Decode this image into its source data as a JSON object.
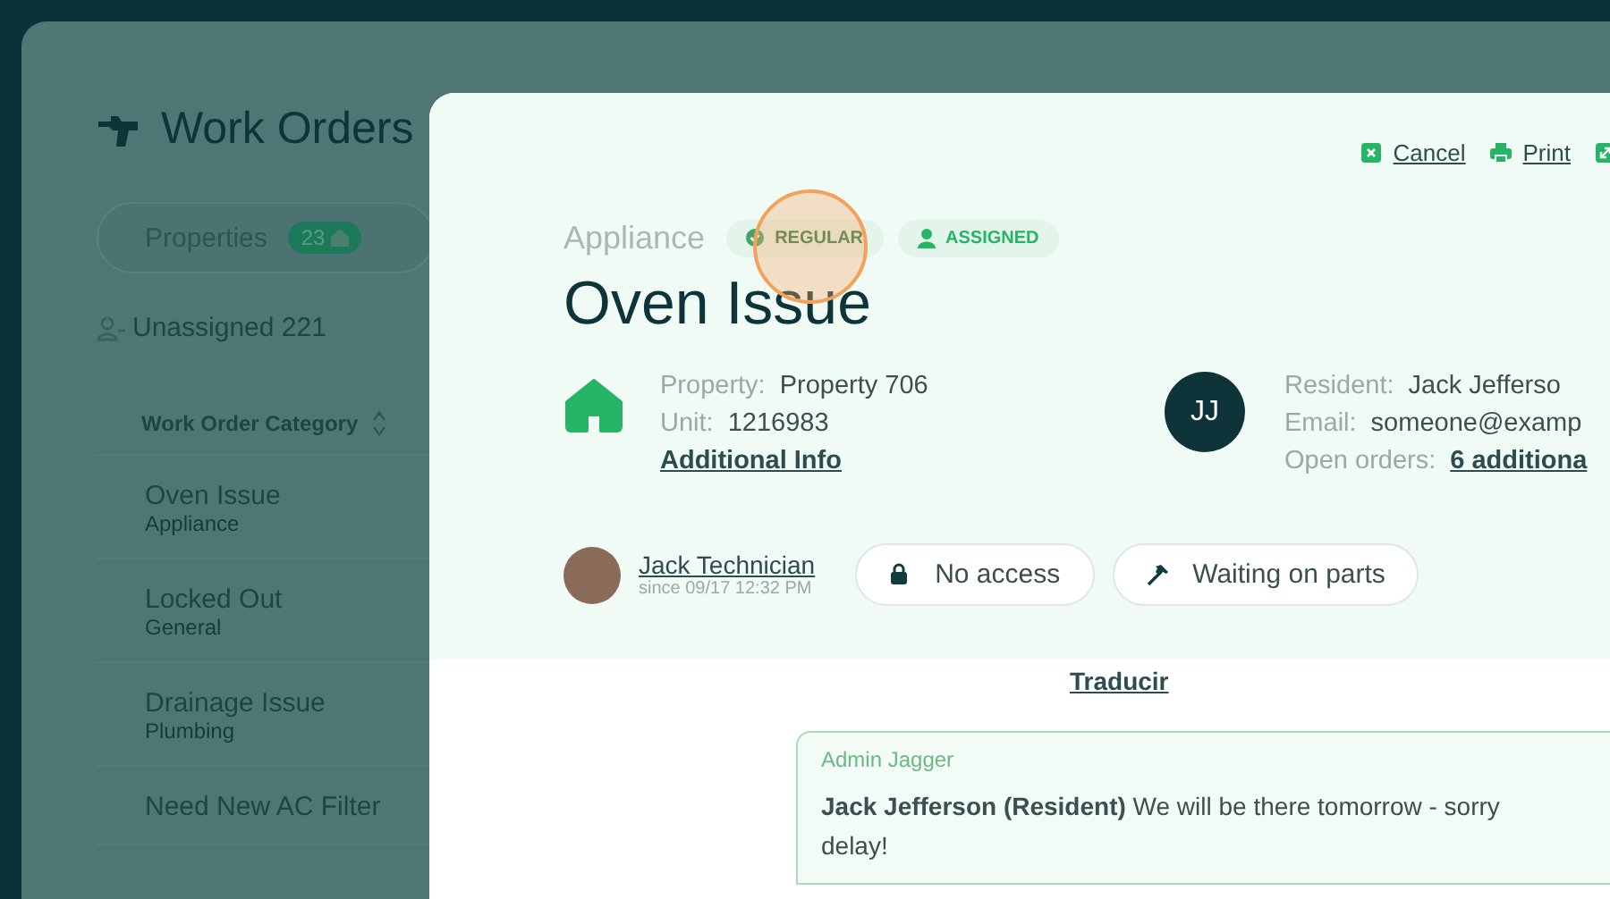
{
  "background": {
    "title": "Work Orders",
    "filter": {
      "label": "Properties",
      "count": "23"
    },
    "unassigned": "Unassigned 221",
    "table": {
      "column": "Work Order Category",
      "rows": [
        {
          "title": "Oven Issue",
          "category": "Appliance"
        },
        {
          "title": "Locked Out",
          "category": "General"
        },
        {
          "title": "Drainage Issue",
          "category": "Plumbing"
        },
        {
          "title": "Need New AC Filter"
        }
      ]
    }
  },
  "modal": {
    "actions": [
      {
        "kind": "cancel",
        "label": "Cancel"
      },
      {
        "kind": "print",
        "label": "Print"
      },
      {
        "kind": "expand"
      }
    ],
    "category": "Appliance",
    "badges": [
      {
        "kind": "priority",
        "label": "REGULAR"
      },
      {
        "kind": "assigned",
        "label": "ASSIGNED"
      }
    ],
    "title": "Oven Issue",
    "property": [
      {
        "label": "Property:",
        "value": "Property 706"
      },
      {
        "label": "Unit:",
        "value": "1216983"
      }
    ],
    "additional_info": "Additional Info",
    "resident": {
      "initials": "JJ",
      "fields": [
        {
          "kind": "text",
          "label": "Resident:",
          "value": "Jack Jefferso"
        },
        {
          "kind": "text",
          "label": "Email:",
          "value": "someone@examp"
        },
        {
          "kind": "link",
          "label": "Open orders:",
          "value": "6 additiona"
        }
      ]
    },
    "technician": {
      "name": "Jack Technician",
      "since": "since 09/17 12:32 PM"
    },
    "status_chips": [
      {
        "kind": "lock",
        "label": "No access"
      },
      {
        "kind": "hammer",
        "label": "Waiting on parts"
      }
    ],
    "translate_link": "Traducir",
    "messages": [
      {
        "author": "Admin Jagger",
        "lines": [
          "**Jack Jefferson (Resident)** We will be there tomorrow - sorry",
          "delay!"
        ]
      }
    ]
  }
}
